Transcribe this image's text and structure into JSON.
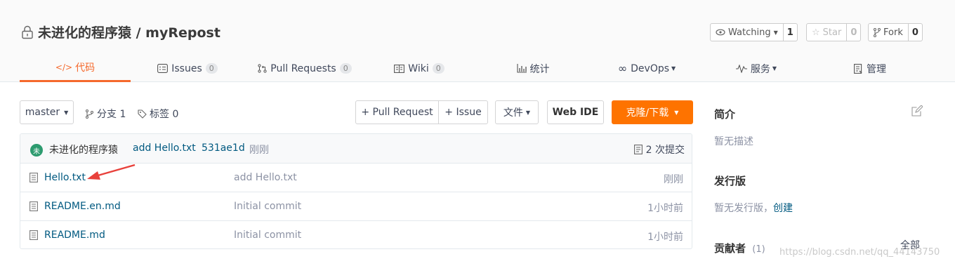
{
  "repo": {
    "title": "未进化的程序猿 / myRepost",
    "watch_label": "Watching",
    "watch_count": "1",
    "star_label": "Star",
    "star_count": "0",
    "fork_label": "Fork",
    "fork_count": "0"
  },
  "tabs": [
    {
      "label": "代码",
      "icon": "code-icon",
      "active": true
    },
    {
      "label": "Issues",
      "badge": "0",
      "icon": "issues-icon"
    },
    {
      "label": "Pull Requests",
      "badge": "0",
      "icon": "pull-request-icon"
    },
    {
      "label": "Wiki",
      "badge": "0",
      "icon": "wiki-icon"
    },
    {
      "label": "统计",
      "icon": "stats-icon"
    },
    {
      "label": "DevOps",
      "icon": "devops-icon"
    },
    {
      "label": "服务",
      "icon": "service-icon"
    },
    {
      "label": "管理",
      "icon": "manage-icon"
    }
  ],
  "toolbar": {
    "branch": "master",
    "branches": "分支 1",
    "tags": "标签 0",
    "pull_request": "+ Pull Request",
    "issue": "+ Issue",
    "file": "文件",
    "web_ide": "Web IDE",
    "clone": "克隆/下载"
  },
  "commit": {
    "avatar_text": "未",
    "author": "未进化的程序猿",
    "message": "add Hello.txt",
    "sha": "531ae1d",
    "time": "刚刚",
    "count": "2 次提交"
  },
  "files": [
    {
      "name": "Hello.txt",
      "message": "add Hello.txt",
      "time": "刚刚"
    },
    {
      "name": "README.en.md",
      "message": "Initial commit",
      "time": "1小时前"
    },
    {
      "name": "README.md",
      "message": "Initial commit",
      "time": "1小时前"
    }
  ],
  "sidebar": {
    "intro_title": "简介",
    "intro_text": "暂无描述",
    "release_title": "发行版",
    "release_text": "暂无发行版，",
    "release_link": "创建",
    "contrib_title": "贡献者",
    "contrib_count": "(1)",
    "contrib_all": "全部"
  },
  "watermark": "https://blog.csdn.net/qq_44143750",
  "colors": {
    "accent": "#f5692c",
    "clone_button": "#fe7300",
    "link": "#005980",
    "annotation_arrow": "#e8413b"
  }
}
